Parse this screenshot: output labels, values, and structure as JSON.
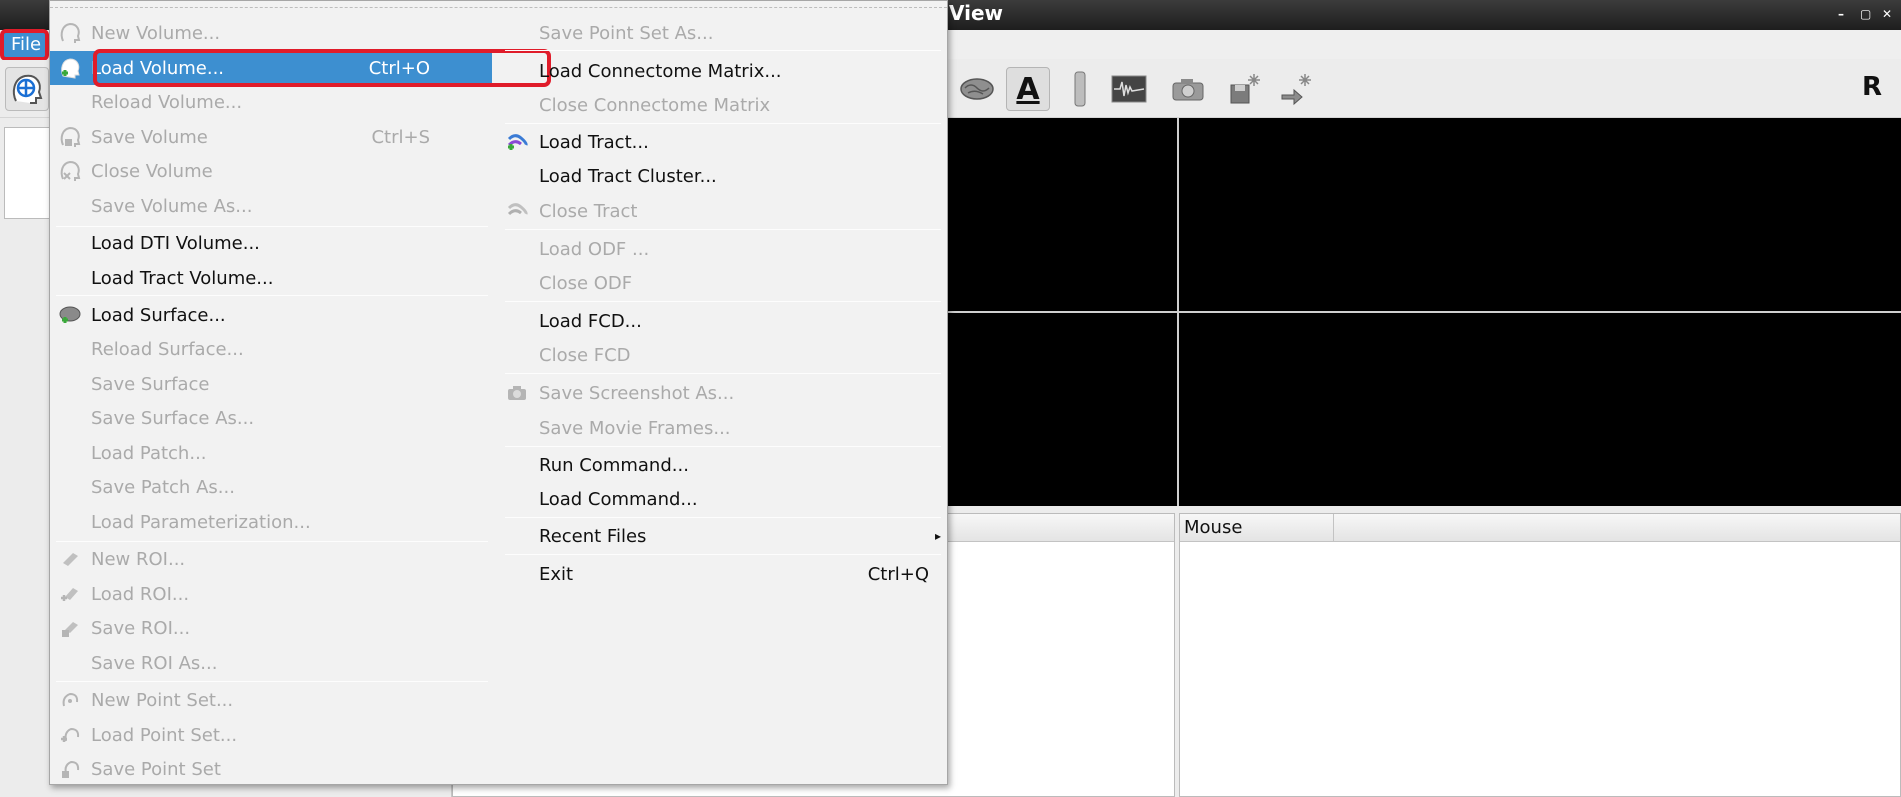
{
  "window": {
    "title": "View",
    "buttons": [
      "–",
      "▢",
      "✕"
    ]
  },
  "menubar": {
    "file_label": "File"
  },
  "toolbar": {
    "text_tool_label": "A",
    "orientation_label": "R"
  },
  "info_panels": {
    "mouse_header": "Mouse"
  },
  "file_menu": {
    "col1": {
      "new_volume": "New Volume...",
      "load_volume": "Load Volume...",
      "load_volume_shortcut": "Ctrl+O",
      "reload_volume": "Reload Volume...",
      "save_volume": "Save Volume",
      "save_volume_shortcut": "Ctrl+S",
      "close_volume": "Close Volume",
      "save_volume_as": "Save Volume As...",
      "load_dti_volume": "Load DTI Volume...",
      "load_tract_volume": "Load Tract Volume...",
      "load_surface": "Load Surface...",
      "reload_surface": "Reload Surface...",
      "save_surface": "Save Surface",
      "save_surface_as": "Save Surface As...",
      "load_patch": "Load Patch...",
      "save_patch_as": "Save Patch As...",
      "load_parameterization": "Load Parameterization...",
      "new_roi": "New ROI...",
      "load_roi": "Load ROI...",
      "save_roi": "Save ROI...",
      "save_roi_as": "Save ROI As...",
      "new_point_set": "New Point Set...",
      "load_point_set": "Load Point Set...",
      "save_point_set": "Save Point Set"
    },
    "col2": {
      "save_point_set_as": "Save Point Set As...",
      "load_connectome_matrix": "Load Connectome Matrix...",
      "close_connectome_matrix": "Close Connectome Matrix",
      "load_tract": "Load Tract...",
      "load_tract_cluster": "Load Tract Cluster...",
      "close_tract": "Close Tract",
      "load_odf": "Load ODF ...",
      "close_odf": "Close ODF",
      "load_fcd": "Load FCD...",
      "close_fcd": "Close FCD",
      "save_screenshot_as": "Save Screenshot As...",
      "save_movie_frames": "Save Movie Frames...",
      "run_command": "Run Command...",
      "load_command": "Load Command...",
      "recent_files": "Recent Files",
      "exit": "Exit",
      "exit_shortcut": "Ctrl+Q"
    }
  },
  "colors": {
    "highlight": "#3d8fd0",
    "annotation_ring": "#e01c2a",
    "disabled_text": "#aaaaaa"
  }
}
